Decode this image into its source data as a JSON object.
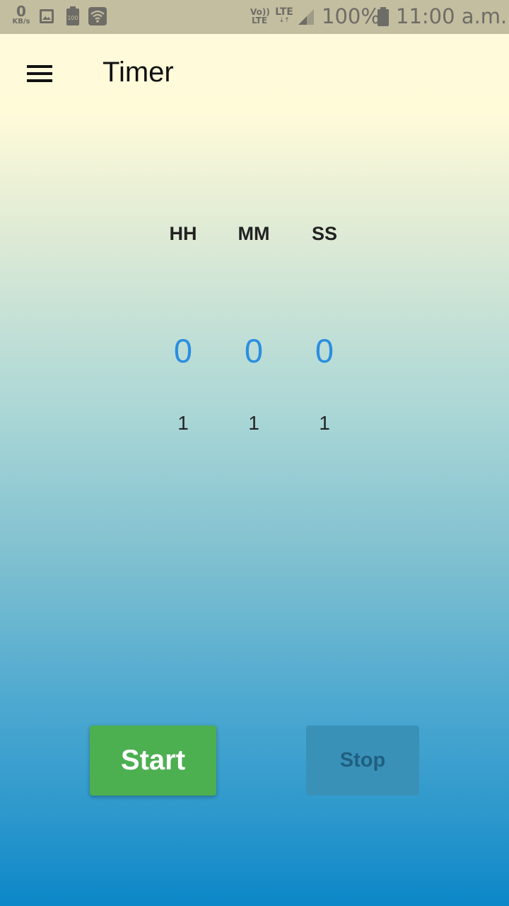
{
  "status_bar": {
    "speed_value": "0",
    "speed_unit": "KB/s",
    "battery_icon_label": "100",
    "volte_line1": "Vo))",
    "volte_line2": "LTE",
    "lte_label": "LTE",
    "battery_percent": "100%",
    "time": "11:00 a.m.",
    "icons": [
      "image-icon",
      "battery-saver-icon",
      "wifi-icon",
      "signal-icon",
      "battery-icon"
    ]
  },
  "app_bar": {
    "title": "Timer",
    "menu_icon": "hamburger-menu-icon"
  },
  "timer": {
    "columns": [
      {
        "label": "HH",
        "value": "0",
        "next": "1"
      },
      {
        "label": "MM",
        "value": "0",
        "next": "1"
      },
      {
        "label": "SS",
        "value": "0",
        "next": "1"
      }
    ]
  },
  "buttons": {
    "start_label": "Start",
    "stop_label": "Stop"
  },
  "colors": {
    "status_bar": "#c3bea0",
    "gradient_top": "#fffbdb",
    "gradient_bottom": "#0c87c8",
    "picker_value": "#2a8ee0",
    "start_button": "#4caf50",
    "stop_button_disabled": "#3a91b8"
  }
}
